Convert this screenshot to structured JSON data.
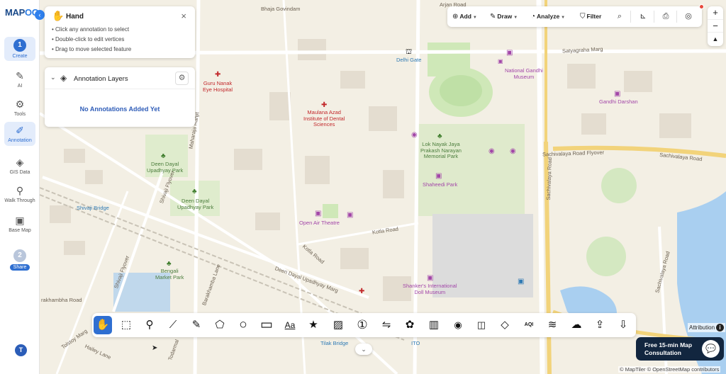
{
  "app": {
    "logo_main": "MAP",
    "logo_accent": "OG",
    "collapse_icon": "chevron-left-icon"
  },
  "sidebar": {
    "step1": {
      "number": "1",
      "label": "Create"
    },
    "items": [
      {
        "label": "AI",
        "icon": "ai-icon",
        "glyph": "✎"
      },
      {
        "label": "Tools",
        "icon": "tools-icon",
        "glyph": "⚙"
      },
      {
        "label": "Annotation",
        "icon": "annotation-icon",
        "glyph": "✐",
        "active": true
      },
      {
        "label": "GIS Data",
        "icon": "layers-icon",
        "glyph": "◈"
      },
      {
        "label": "Walk Through",
        "icon": "walk-icon",
        "glyph": "⚲"
      },
      {
        "label": "Base Map",
        "icon": "basemap-icon",
        "glyph": "▣"
      }
    ],
    "step2": {
      "number": "2",
      "label": "Share"
    },
    "avatar": "T"
  },
  "hand_panel": {
    "title": "Hand",
    "close": "×",
    "tips": [
      "• Click any annotation to select",
      "• Double-click to edit vertices",
      "• Drag to move selected feature"
    ]
  },
  "layers_panel": {
    "title": "Annotation Layers",
    "empty_text": "No Annotations Added Yet"
  },
  "top_toolbar": {
    "add": "Add",
    "draw": "Draw",
    "analyze": "Analyze",
    "filter": "Filter"
  },
  "zoom": {
    "in": "+",
    "out": "−",
    "north": "▲"
  },
  "bottom_toolbar": {
    "tools": [
      {
        "name": "hand-tool",
        "glyph": "✋"
      },
      {
        "name": "select-tool",
        "glyph": "⬚"
      },
      {
        "name": "marker-tool",
        "glyph": "⚲"
      },
      {
        "name": "line-tool",
        "glyph": "⟋"
      },
      {
        "name": "pen-tool",
        "glyph": "✎"
      },
      {
        "name": "polygon-tool",
        "glyph": "⬠"
      },
      {
        "name": "circle-tool",
        "glyph": "○"
      },
      {
        "name": "rectangle-tool",
        "glyph": "▭"
      },
      {
        "name": "text-tool",
        "glyph": "Aa"
      },
      {
        "name": "star-tool",
        "glyph": "★"
      },
      {
        "name": "image-tool",
        "glyph": "▨"
      },
      {
        "name": "number-tool",
        "glyph": "①"
      },
      {
        "name": "route-tool",
        "glyph": "⇋"
      },
      {
        "name": "freehand-area-tool",
        "glyph": "✿"
      },
      {
        "name": "building-tool",
        "glyph": "▥"
      },
      {
        "name": "camera-tool",
        "glyph": "◉"
      },
      {
        "name": "photo-tool",
        "glyph": "◫"
      },
      {
        "name": "3d-box-tool",
        "glyph": "◇"
      },
      {
        "name": "aqi-tool",
        "glyph": "AQI"
      },
      {
        "name": "wind-tool",
        "glyph": "≋"
      },
      {
        "name": "weather-tool",
        "glyph": "☁"
      },
      {
        "name": "upload-tool",
        "glyph": "⇪"
      },
      {
        "name": "download-tool",
        "glyph": "⇩"
      }
    ]
  },
  "cta": {
    "line1": "Free 15-min Map",
    "line2": "Consultation"
  },
  "attribution": {
    "label": "Attribution",
    "copyright": "© MapTiler © OpenStreetMap contributors"
  },
  "map_labels": {
    "arjan_road": "Arjan Road",
    "bhaja_govindam": "Bhaja Govindam",
    "satyagraha_marg": "Satyagraha Marg",
    "delhi_gate": "Delhi Gate",
    "national_gandhi_museum": "National Gandhi\nMuseum",
    "guru_nanak": "Guru Nanak\nEye Hospital",
    "maulana_azad": "Maulana Azad\nInstitute of Dental\nSciences",
    "gandhi_darshan": "Gandhi Darshan",
    "lok_nayak": "Lok Nayak Jaya\nPrakash Narayan\nMemorial Park",
    "deen_dayal_1": "Deen Dayal\nUpadhyay Park",
    "deen_dayal_2": "Deen Dayal\nUpadhyay Park",
    "shaheedi_park": "Shaheedi Park",
    "shivaji_bridge": "Shivaji Bridge",
    "open_air_theatre": "Open Air Theatre",
    "kotla_road": "Kotla Road",
    "kotla_road_2": "Kotla Road",
    "ddu_marg": "Deen Dayal Upadhyay Marg",
    "bengali_market": "Bengali\nMarket Park",
    "shankers_museum": "Shanker's International\nDoll Museum",
    "sachivalaya_flyover": "Sachivalaya Road Flyover",
    "sachivalaya_road": "Sachivalaya Road",
    "sachivalaya_road_2": "Sachivalaya Road",
    "shivaji_flyover": "Shivaji Flyover",
    "tilak_bridge": "Tilak Bridge",
    "ito": "ITO",
    "rakhambha_road": "rakhambha Road",
    "tolstoy_marg": "Tolstoy Marg",
    "hailey_lane": "Hailey Lane",
    "barakhamba_lane": "Barakhamba Lane",
    "maharaja_ranjit": "Maharaja Ranjit",
    "todarmal": "Todarmal"
  }
}
